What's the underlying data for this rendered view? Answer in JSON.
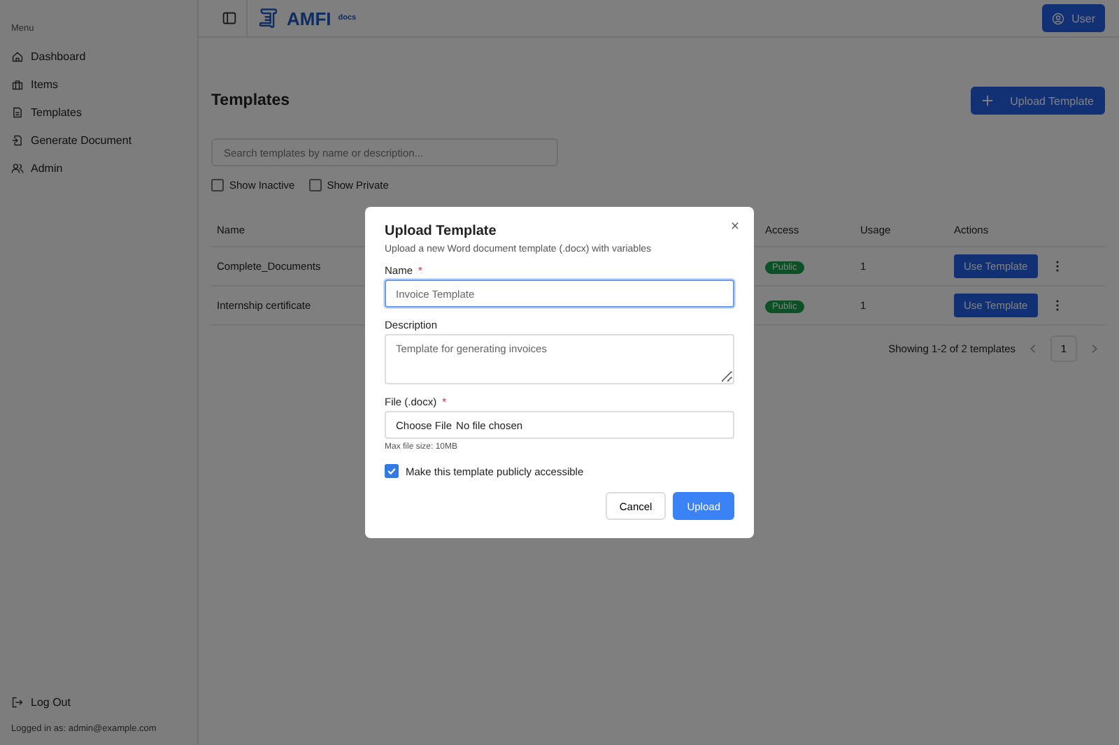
{
  "sidebar": {
    "heading": "Menu",
    "items": [
      {
        "label": "Dashboard"
      },
      {
        "label": "Items"
      },
      {
        "label": "Templates"
      },
      {
        "label": "Generate Document"
      },
      {
        "label": "Admin"
      }
    ],
    "logout": "Log Out",
    "logged_in": "Logged in as: admin@example.com"
  },
  "header": {
    "logo": "AMFI",
    "logo_sub": "docs",
    "user_button": "User"
  },
  "page": {
    "title": "Templates",
    "upload_button": "Upload Template",
    "search": {
      "placeholder": "Search templates by name or description..."
    },
    "filters": [
      {
        "label": "Show Inactive",
        "checked": false
      },
      {
        "label": "Show Private",
        "checked": false
      }
    ],
    "table": {
      "columns": [
        "Name",
        "Access",
        "Usage",
        "Actions"
      ],
      "rows": [
        {
          "name": "Complete_Documents",
          "access": "Public",
          "usage": "1",
          "action": "Use Template"
        },
        {
          "name": "Internship certificate",
          "access": "Public",
          "usage": "1",
          "action": "Use Template"
        }
      ]
    },
    "pagination": {
      "summary": "Showing 1-2 of 2 templates",
      "pages": [
        {
          "label": "1"
        }
      ]
    }
  },
  "modal": {
    "title": "Upload Template",
    "subtitle": "Upload a new Word document template (.docx) with variables",
    "name_field": {
      "label": "Name",
      "required_mark": "*",
      "placeholder": "Invoice Template"
    },
    "description_field": {
      "label": "Description",
      "placeholder": "Template for generating invoices"
    },
    "file_field": {
      "label": "File (.docx)",
      "required_mark": "*",
      "button": "Choose File",
      "status": "No file chosen",
      "hint": "Max file size: 10MB"
    },
    "public_option": {
      "label": "Make this template publicly accessible",
      "checked": true
    },
    "buttons": {
      "cancel": "Cancel",
      "submit": "Upload"
    }
  }
}
